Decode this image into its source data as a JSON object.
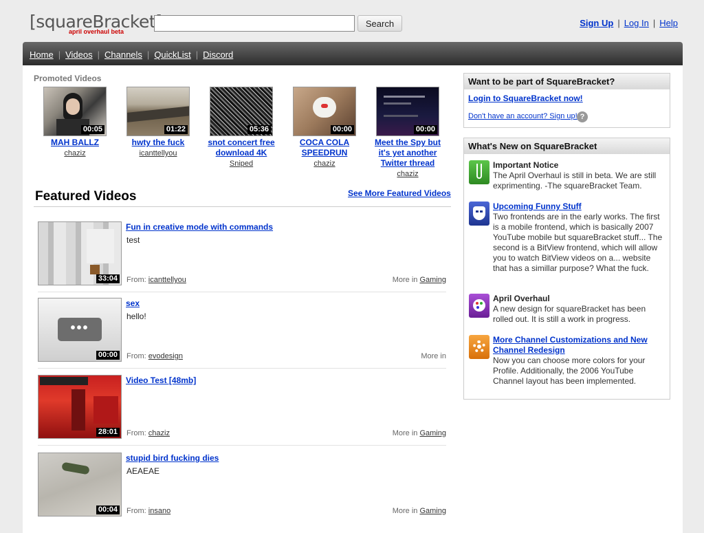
{
  "header": {
    "logo_main": "[squareBracket]",
    "logo_sub": "april overhaul beta",
    "search_placeholder": "",
    "search_button": "Search",
    "sign_up": "Sign Up",
    "log_in": "Log In",
    "help": "Help",
    "separator": "|"
  },
  "nav": {
    "items": [
      "Home",
      "Videos",
      "Channels",
      "QuickList",
      "Discord"
    ],
    "separator": "|"
  },
  "promoted": {
    "title": "Promoted Videos",
    "videos": [
      {
        "title": "MAH BALLZ",
        "user": "chaziz",
        "duration": "00:05"
      },
      {
        "title": "hwty the fuck",
        "user": "icanttellyou",
        "duration": "01:22"
      },
      {
        "title": "snot concert free download 4K",
        "user": "Sniped",
        "duration": "05:36"
      },
      {
        "title": "COCA COLA SPEEDRUN",
        "user": "chaziz",
        "duration": "00:00"
      },
      {
        "title": "Meet the Spy but it's yet another Twitter thread",
        "user": "chaziz",
        "duration": "00:00"
      }
    ]
  },
  "featured": {
    "title": "Featured Videos",
    "see_more": "See More Featured Videos",
    "from_label": "From:",
    "more_in_label": "More in",
    "videos": [
      {
        "title": "Fun in creative mode with commands",
        "desc": "test",
        "user": "icanttellyou",
        "category": "Gaming",
        "duration": "33:04"
      },
      {
        "title": "sex",
        "desc": "hello!",
        "user": "evodesign",
        "category": "",
        "duration": "00:00"
      },
      {
        "title": "Video Test [48mb]",
        "desc": "",
        "user": "chaziz",
        "category": "Gaming",
        "duration": "28:01"
      },
      {
        "title": "stupid bird fucking dies",
        "desc": "AEAEAE",
        "user": "insano",
        "category": "Gaming",
        "duration": "00:04"
      }
    ]
  },
  "sidebar": {
    "join": {
      "title": "Want to be part of SquareBracket?",
      "login_link": "Login to SquareBracket now!",
      "signup_link": "Don't have an account? Sign up!",
      "help_glyph": "?"
    },
    "news": {
      "title": "What's New on SquareBracket",
      "items": [
        {
          "title": "Important Notice",
          "linked": false,
          "body": "The April Overhaul is still in beta. We are still exprimenting. -The squareBracket Team.",
          "icon": "flask-icon",
          "color": "#3aa52b"
        },
        {
          "title": "Upcoming Funny Stuff",
          "linked": true,
          "body": "Two frontends are in the early works. The first is a mobile frontend, which is basically 2007 YouTube mobile but squareBracket stuff... The second is a BitView frontend, which will allow you to watch BitView videos on a... website that has a simillar purpose? What the fuck.",
          "icon": "mask-icon",
          "color": "#2a46b8"
        },
        {
          "title": "April Overhaul",
          "linked": false,
          "body": "A new design for squareBracket has been rolled out. It is still a work in progress.",
          "icon": "palette-icon",
          "color": "#8a2fb8"
        },
        {
          "title": "More Channel Customizations and New Channel Redesign",
          "linked": true,
          "body": "Now you can choose more colors for your Profile. Additionally, the 2006 YouTube Channel layout has been implemented.",
          "icon": "gear-icon",
          "color": "#f08a12"
        }
      ]
    }
  },
  "colors": {
    "link": "#0033cc",
    "nav_bg": "#3a3a3a",
    "logo_sub": "#cc0000"
  }
}
